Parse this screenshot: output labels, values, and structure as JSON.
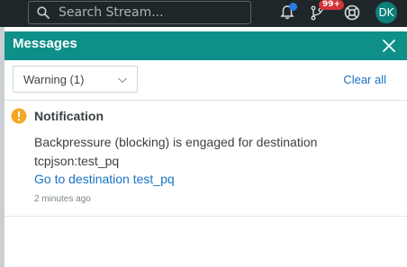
{
  "topbar": {
    "search": {
      "placeholder": "Search Stream..."
    },
    "icons": {
      "search": "search-icon",
      "notifications": "bell-icon",
      "pull_requests": "git-branch-icon",
      "help": "life-ring-icon"
    },
    "pr_badge": "99+",
    "avatar_initials": "DK"
  },
  "panel": {
    "title": "Messages",
    "close_icon": "close-icon",
    "filter": {
      "selected": "Warning (1)",
      "icon": "chevron-down-icon"
    },
    "clear_all": "Clear all",
    "messages": [
      {
        "icon": "warning-icon",
        "title": "Notification",
        "body": "Backpressure (blocking) is engaged for destination tcpjson:test_pq",
        "link": "Go to destination test_pq",
        "time": "2 minutes ago"
      }
    ]
  },
  "colors": {
    "topbar_bg": "#1f2629",
    "header_teal": "#0f8f8a",
    "link_blue": "#1a73c7",
    "warning_orange": "#f5a623",
    "badge_red": "#d13438",
    "avatar_teal": "#0f7f7a",
    "notify_dot_blue": "#2c7be5"
  }
}
